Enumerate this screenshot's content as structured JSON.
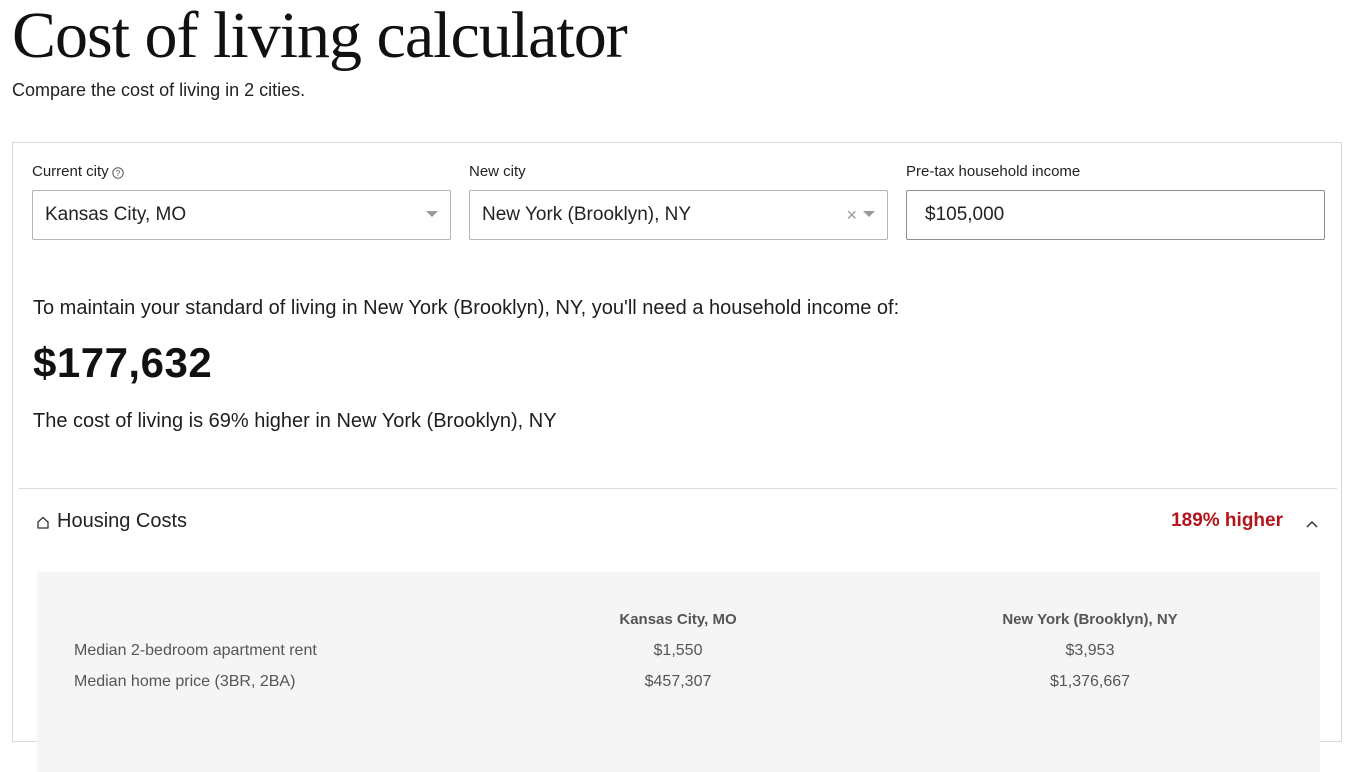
{
  "header": {
    "title": "Cost of living calculator",
    "subtitle": "Compare the cost of living in 2 cities."
  },
  "form": {
    "current_city": {
      "label": "Current city",
      "value": "Kansas City, MO",
      "icon": "help-circle-icon"
    },
    "new_city": {
      "label": "New city",
      "value": "New York (Brooklyn), NY",
      "clear_icon": "×"
    },
    "income": {
      "label": "Pre-tax household income",
      "value": "$105,000"
    }
  },
  "result": {
    "intro": "To maintain your standard of living in New York (Brooklyn), NY, you'll need a household income of:",
    "amount": "$177,632",
    "comparison": "The cost of living is 69% higher in New York (Brooklyn), NY"
  },
  "sections": [
    {
      "title": "Housing Costs",
      "icon": "house-icon",
      "badge": "189% higher",
      "badge_color": "#b3131b",
      "expanded": true,
      "table": {
        "columns": [
          "",
          "Kansas City, MO",
          "New York (Brooklyn), NY"
        ],
        "rows": [
          {
            "label": "Median 2-bedroom apartment rent",
            "a": "$1,550",
            "b": "$3,953"
          },
          {
            "label": "Median home price (3BR, 2BA)",
            "a": "$457,307",
            "b": "$1,376,667"
          }
        ]
      }
    }
  ]
}
